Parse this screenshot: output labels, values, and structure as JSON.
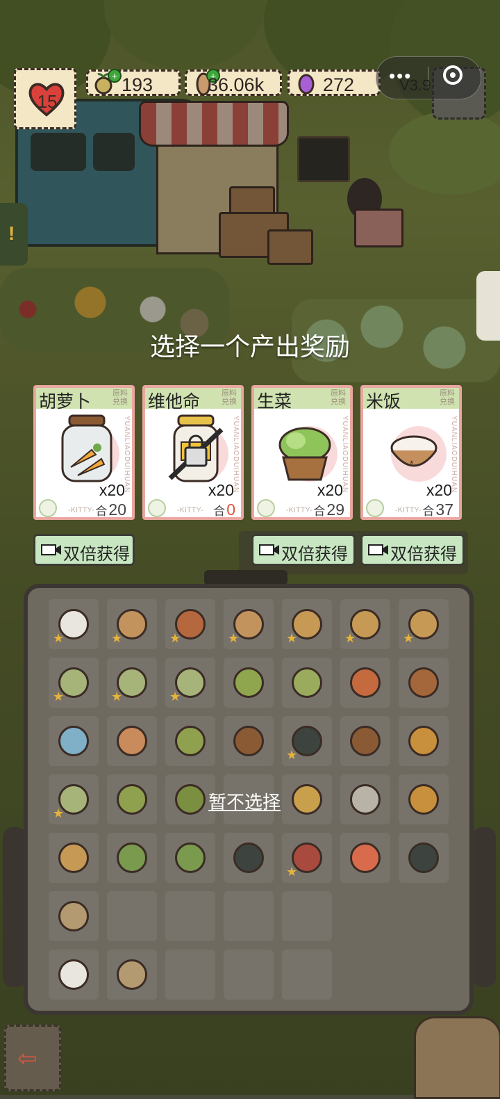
{
  "hud": {
    "level": "15",
    "currency_1": "193",
    "currency_2": "36.06k",
    "currency_3": "272",
    "version": "V3.9"
  },
  "prompt": "选择一个产出奖励",
  "cards": [
    {
      "name": "胡萝卜",
      "tag_line1": "原料",
      "tag_line2": "兑换",
      "side_text": "YUANLIAODUIHUAN",
      "quantity": "x20",
      "stock": "20",
      "stock_prefix": "合",
      "watermark": "-KITTY-",
      "icon": "carrot-jar-icon"
    },
    {
      "name": "维他命",
      "tag_line1": "原料",
      "tag_line2": "兑换",
      "side_text": "YUANLIAODUIHUAN",
      "quantity": "x20",
      "stock": "0",
      "stock_prefix": "合",
      "watermark": "-KITTY-",
      "icon": "vitamin-jar-locked-icon"
    },
    {
      "name": "生菜",
      "tag_line1": "原料",
      "tag_line2": "兑换",
      "side_text": "YUANLIAODUIHUAN",
      "quantity": "x20",
      "stock": "29",
      "stock_prefix": "合",
      "watermark": "-KITTY-",
      "icon": "lettuce-basket-icon"
    },
    {
      "name": "米饭",
      "tag_line1": "原料",
      "tag_line2": "兑换",
      "side_text": "YUANLIAODUIHUAN",
      "quantity": "x20",
      "stock": "37",
      "stock_prefix": "合",
      "watermark": "-KITTY-",
      "icon": "rice-bowl-icon"
    }
  ],
  "double_buttons": [
    {
      "label": "双倍获得"
    },
    {
      "label": "双倍获得"
    },
    {
      "label": "双倍获得"
    }
  ],
  "skip_label": "暂不选择",
  "colors": {
    "card_border": "#e9a7a0",
    "card_header": "#cfe2b0",
    "button_green": "#c7e6c1",
    "panel": "#6e6a60",
    "star": "#e7b33b"
  }
}
